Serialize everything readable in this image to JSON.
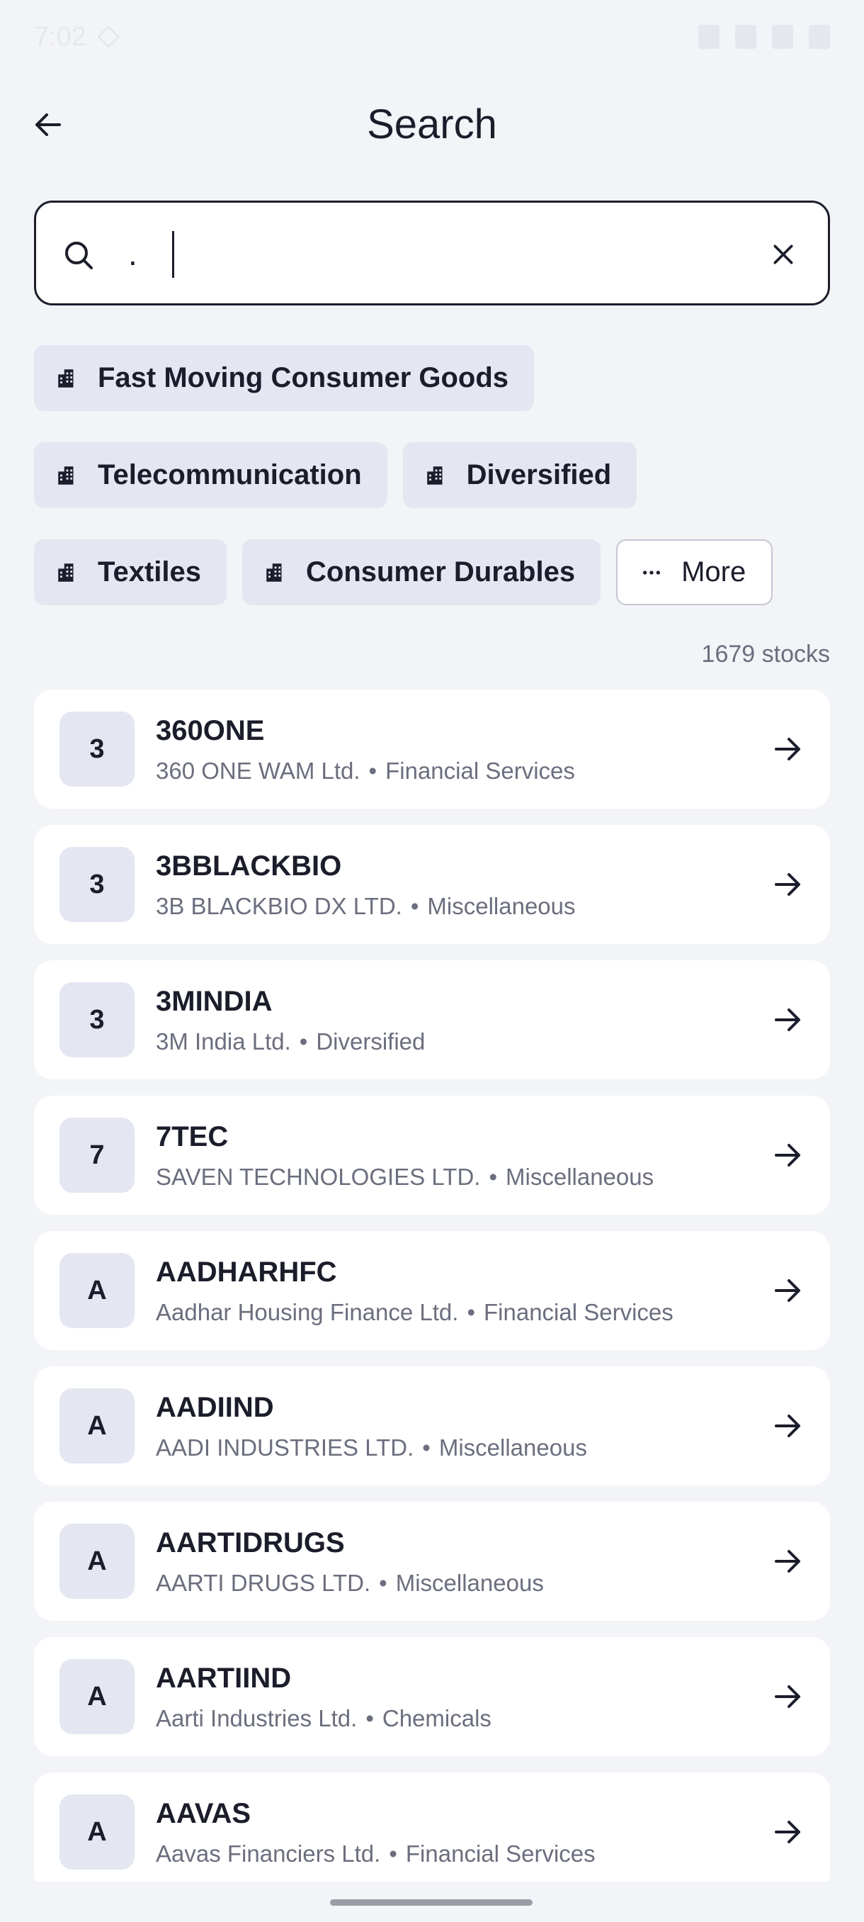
{
  "status_bar": {
    "time": "7:02"
  },
  "appbar": {
    "title": "Search"
  },
  "search": {
    "value": ".",
    "placeholder": ""
  },
  "chips": {
    "row1": [
      "Fast Moving Consumer Goods"
    ],
    "row2": [
      "Telecommunication",
      "Diversified"
    ],
    "row3": [
      "Textiles",
      "Consumer Durables"
    ],
    "more_label": "More"
  },
  "results": {
    "count_label": "1679 stocks",
    "items": [
      {
        "avatar": "3",
        "symbol": "360ONE",
        "name": "360 ONE WAM Ltd.",
        "sector": "Financial Services"
      },
      {
        "avatar": "3",
        "symbol": "3BBLACKBIO",
        "name": "3B BLACKBIO DX LTD.",
        "sector": "Miscellaneous"
      },
      {
        "avatar": "3",
        "symbol": "3MINDIA",
        "name": "3M India Ltd.",
        "sector": "Diversified"
      },
      {
        "avatar": "7",
        "symbol": "7TEC",
        "name": "SAVEN TECHNOLOGIES LTD.",
        "sector": "Miscellaneous"
      },
      {
        "avatar": "A",
        "symbol": "AADHARHFC",
        "name": "Aadhar Housing Finance Ltd.",
        "sector": "Financial Services"
      },
      {
        "avatar": "A",
        "symbol": "AADIIND",
        "name": "AADI INDUSTRIES LTD.",
        "sector": "Miscellaneous"
      },
      {
        "avatar": "A",
        "symbol": "AARTIDRUGS",
        "name": "AARTI DRUGS LTD.",
        "sector": "Miscellaneous"
      },
      {
        "avatar": "A",
        "symbol": "AARTIIND",
        "name": "Aarti Industries Ltd.",
        "sector": "Chemicals"
      },
      {
        "avatar": "A",
        "symbol": "AAVAS",
        "name": "Aavas Financiers Ltd.",
        "sector": "Financial Services"
      }
    ]
  },
  "icons": {
    "back": "arrow-left-icon",
    "search": "search-icon",
    "clear": "close-icon",
    "chip": "building-icon",
    "more": "more-dots-icon",
    "row_arrow": "arrow-right-icon"
  },
  "colors": {
    "background": "#f3f4f8",
    "chip_bg": "#e4e6f1",
    "text": "#1b1d2b",
    "muted": "#6b6e7e",
    "card": "#ffffff"
  }
}
